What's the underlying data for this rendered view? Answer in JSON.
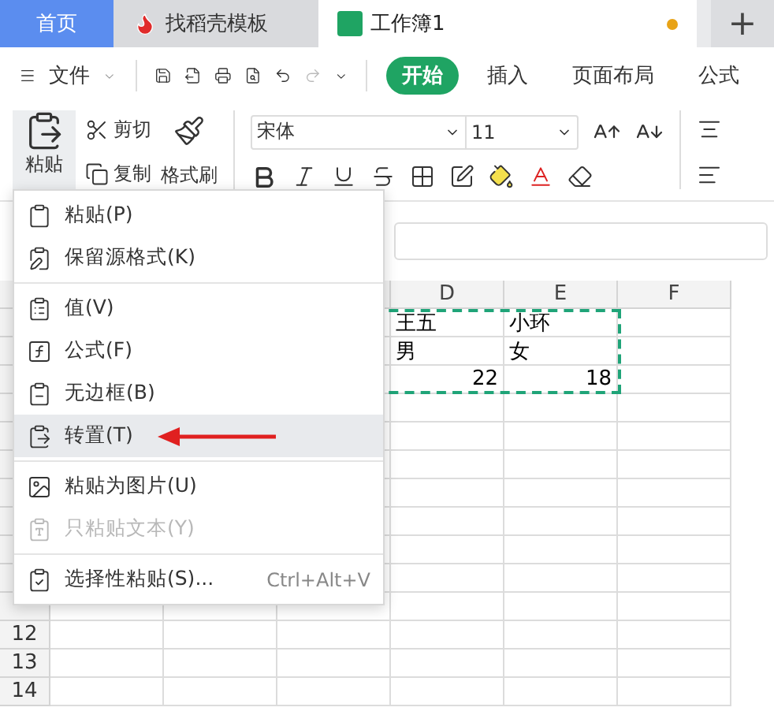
{
  "tabs": [
    {
      "label": "首页",
      "kind": "home",
      "selected": false
    },
    {
      "label": "找稻壳模板",
      "kind": "template",
      "selected": false
    },
    {
      "label": "工作簿1",
      "kind": "sheet",
      "selected": true,
      "modified": true
    }
  ],
  "new_tab": "+",
  "menu_bar": {
    "file_menu": "文件",
    "ribbon_tabs": [
      {
        "label": "开始",
        "selected": true
      },
      {
        "label": "插入",
        "selected": false
      },
      {
        "label": "页面布局",
        "selected": false
      },
      {
        "label": "公式",
        "selected": false
      }
    ]
  },
  "ribbon": {
    "paste": "粘贴",
    "cut": "剪切",
    "copy": "复制",
    "format_painter": "格式刷",
    "font_name": "宋体",
    "font_size": "11"
  },
  "grid": {
    "columns": [
      "D",
      "E",
      "F"
    ],
    "rows": [
      {
        "cells": [
          {
            "text": "王五",
            "kind": "text"
          },
          {
            "text": "小环",
            "kind": "text"
          }
        ]
      },
      {
        "cells": [
          {
            "text": "男",
            "kind": "text"
          },
          {
            "text": "女",
            "kind": "text"
          }
        ]
      },
      {
        "cells": [
          {
            "text": "22",
            "kind": "number"
          },
          {
            "text": "18",
            "kind": "number"
          }
        ]
      },
      {
        "cells": []
      },
      {
        "cells": []
      },
      {
        "cells": []
      },
      {
        "cells": []
      },
      {
        "cells": []
      },
      {
        "cells": []
      },
      {
        "cells": []
      },
      {
        "cells": []
      },
      {
        "number": "12",
        "cells": []
      },
      {
        "number": "13",
        "cells": []
      },
      {
        "number": "14",
        "cells": []
      }
    ]
  },
  "paste_menu": {
    "groups": [
      [
        {
          "label": "粘贴(P)",
          "selected": false,
          "disabled": false
        },
        {
          "label": "保留源格式(K)",
          "selected": false,
          "disabled": false
        }
      ],
      [
        {
          "label": "值(V)",
          "selected": false,
          "disabled": false
        },
        {
          "label": "公式(F)",
          "selected": false,
          "disabled": false
        },
        {
          "label": "无边框(B)",
          "selected": false,
          "disabled": false
        },
        {
          "label": "转置(T)",
          "selected": true,
          "disabled": false
        }
      ],
      [
        {
          "label": "粘贴为图片(U)",
          "selected": false,
          "disabled": false
        },
        {
          "label": "只粘贴文本(Y)",
          "selected": false,
          "disabled": true
        }
      ],
      [
        {
          "label": "选择性粘贴(S)...",
          "shortcut": "Ctrl+Alt+V",
          "selected": false,
          "disabled": false
        }
      ]
    ]
  }
}
